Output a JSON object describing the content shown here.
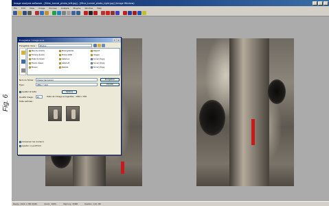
{
  "side_label": "Fig. 6",
  "app": {
    "title": "Image analysis software - [Mine_tunnel_photo_left.jpg] - [Mine_tunnel_photo_right.jpg] (Image Window)",
    "menu": [
      "File",
      "Edit",
      "View",
      "Image",
      "Process",
      "Analyze",
      "Plugins",
      "Window",
      "Help"
    ],
    "status": [
      "Ready: 1024 x 768 (RGB)",
      "Zoom: 100%",
      "Memory: 45MB",
      "Position: 122, 88"
    ]
  },
  "dialog": {
    "title": "Enregistrer l'image sous",
    "save_in_label": "Enregistrer dans :",
    "save_in_value": "Photos",
    "places": [
      "Mes documents",
      "Bureau",
      "Poste de travail"
    ],
    "files": [
      "Mes documents",
      "Fichiers récents",
      "Poste de travail",
      "Favoris réseau",
      "Bureau",
      "Mines galeries",
      "Photos 2006",
      "Galerie A",
      "Galerie B",
      "Relevés",
      "Rapport",
      "Images",
      "tunnel_01.jpg",
      "tunnel_02.jpg",
      "tunnel_03.jpg"
    ],
    "filename_label": "Nom du fichier :",
    "filename_value": "Image tunnel.jpg",
    "type_label": "Type :",
    "type_value": "JPEG (*.jpg)",
    "save_button": "Enregistrer",
    "cancel_button": "Annuler",
    "options_label": "Options",
    "quality_label": "Qualité image :",
    "quality_value": "95",
    "size_label": "Taille estimée :",
    "preview_label": "Taille de l'image enregistrée : 1024 x 768",
    "check1": "Ajuster la taille",
    "check2": "Conserver les couleurs",
    "check3": "Ajouter un profil ICC"
  },
  "colors": {
    "titlebar": "#0a246a",
    "chrome": "#d4d0c8",
    "workspace": "#ababab",
    "accent_red": "#c81a1a"
  }
}
